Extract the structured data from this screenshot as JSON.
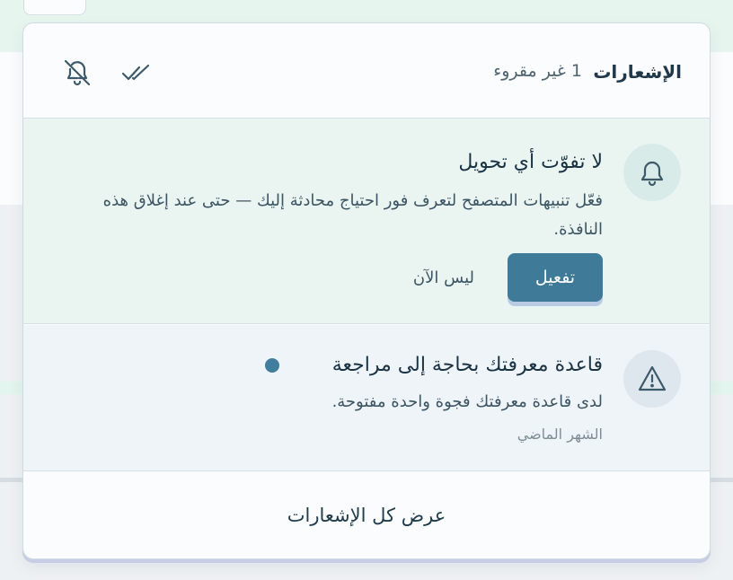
{
  "header": {
    "title": "الإشعارات",
    "unread": "1 غير مقروء",
    "mark_all_read_icon": "double-check-icon",
    "mute_icon": "bell-off-icon"
  },
  "prompt": {
    "icon": "bell-icon",
    "title": "لا تفوّت أي تحويل",
    "description": "فعّل تنبيهات المتصفح لتعرف فور احتياج محادثة إليك — حتى عند إغلاق هذه النافذة.",
    "enable_label": "تفعيل",
    "later_label": "ليس الآن"
  },
  "notifications": [
    {
      "icon": "warning-triangle-icon",
      "title": "قاعدة معرفتك بحاجة إلى مراجعة",
      "body": "لدى قاعدة معرفتك فجوة واحدة مفتوحة.",
      "time": "الشهر الماضي",
      "unread": true
    }
  ],
  "footer": {
    "view_all_label": "عرض كل الإشعارات"
  },
  "colors": {
    "accent": "#3f7a99",
    "prompt_bg": "#eaf5f2",
    "unread_bg": "#eff4f8",
    "unread_dot": "#417d9c"
  }
}
